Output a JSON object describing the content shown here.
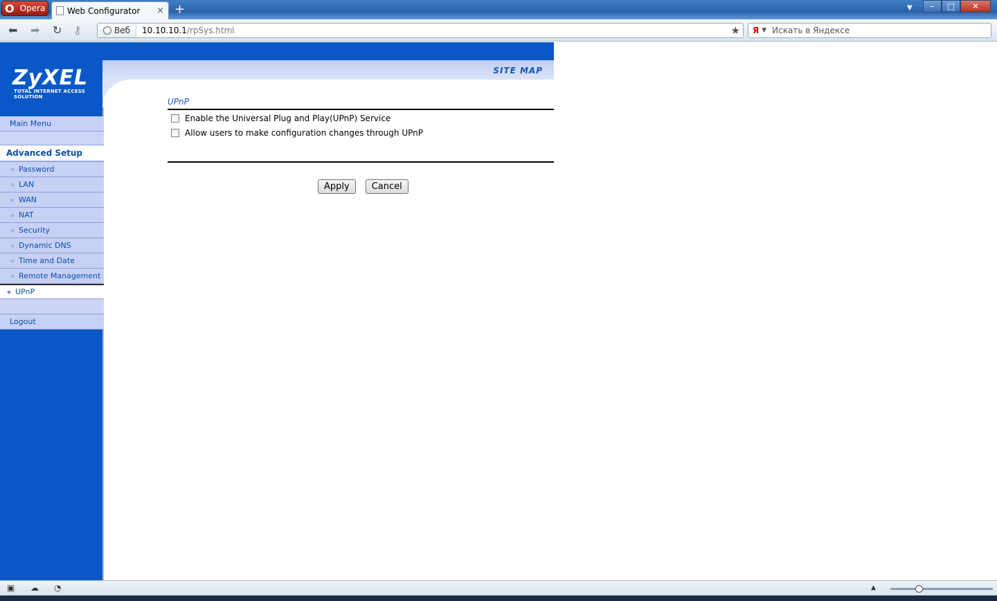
{
  "browser": {
    "menu_label": "Opera",
    "tab_title": "Web Configurator",
    "tab_close": "×",
    "new_tab": "+",
    "address_scheme_label": "Веб",
    "address_host": "10.10.10.1",
    "address_path": "/rpSys.html",
    "search_placeholder": "Искать в Яндексе",
    "search_engine": "Я"
  },
  "header": {
    "brand": "ZyXEL",
    "tagline": "TOTAL INTERNET ACCESS SOLUTION",
    "site_map": "SITE MAP"
  },
  "sidebar": {
    "main_menu": "Main Menu",
    "section": "Advanced Setup",
    "items": [
      {
        "label": "Password"
      },
      {
        "label": "LAN"
      },
      {
        "label": "WAN"
      },
      {
        "label": "NAT"
      },
      {
        "label": "Security"
      },
      {
        "label": "Dynamic DNS"
      },
      {
        "label": "Time and Date"
      },
      {
        "label": "Remote Management"
      }
    ],
    "active_item": "UPnP",
    "logout": "Logout"
  },
  "content": {
    "title": "UPnP",
    "options": [
      {
        "label": "Enable the Universal Plug and Play(UPnP) Service",
        "checked": false
      },
      {
        "label": "Allow users to make configuration changes through UPnP",
        "checked": false
      }
    ],
    "apply_label": "Apply",
    "cancel_label": "Cancel"
  },
  "colors": {
    "sidebar_blue": "#0a58c8",
    "menu_bg": "#c7d0f5",
    "link_blue": "#0b4fa8"
  }
}
